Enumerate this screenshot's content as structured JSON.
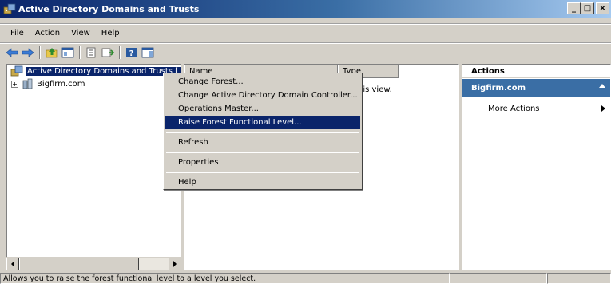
{
  "window": {
    "title": "Active Directory Domains and Trusts",
    "buttons": {
      "minimize": "_",
      "maximize": "□",
      "close": "×"
    }
  },
  "menubar": {
    "items": [
      "File",
      "Action",
      "View",
      "Help"
    ]
  },
  "toolbar": {
    "icons": [
      "back-arrow-icon",
      "forward-arrow-icon",
      "up-level-icon",
      "show-hide-tree-icon",
      "export-list-icon",
      "properties-icon",
      "help-icon",
      "action-pane-icon"
    ]
  },
  "tree": {
    "root": "Active Directory Domains and Trusts [ BF",
    "children": [
      {
        "expander": "+",
        "label": "Bigfirm.com"
      }
    ]
  },
  "list": {
    "columns": [
      "Name",
      "Type"
    ],
    "message": "his view."
  },
  "context_menu": {
    "items": [
      {
        "label": "Change Forest...",
        "highlighted": false
      },
      {
        "label": "Change Active Directory Domain Controller...",
        "highlighted": false
      },
      {
        "label": "Operations Master...",
        "highlighted": false
      },
      {
        "label": "Raise Forest Functional Level...",
        "highlighted": true
      },
      {
        "separator": true
      },
      {
        "label": "Refresh",
        "highlighted": false
      },
      {
        "separator": true
      },
      {
        "label": "Properties",
        "highlighted": false
      },
      {
        "separator": true
      },
      {
        "label": "Help",
        "highlighted": false
      }
    ]
  },
  "actions": {
    "header": "Actions",
    "group": "Bigfirm.com",
    "items": [
      "More Actions"
    ]
  },
  "statusbar": {
    "text": "Allows you to raise the forest functional level to a level you select."
  },
  "colors": {
    "selection": "#0a246a",
    "action_group": "#3a6ea5",
    "face": "#d4d0c8"
  }
}
